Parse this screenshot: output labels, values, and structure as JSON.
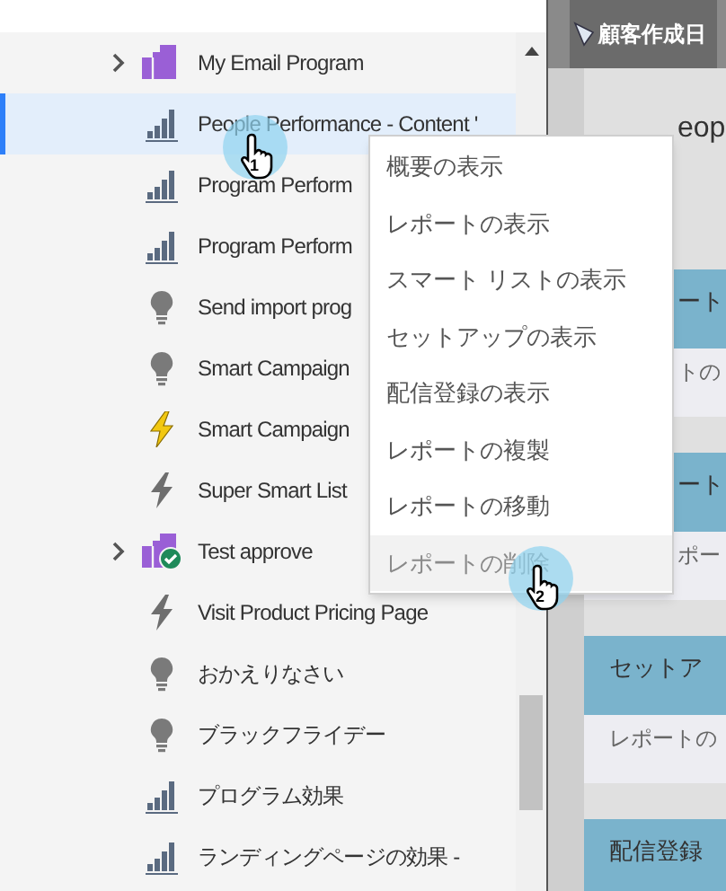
{
  "tree": {
    "items": [
      {
        "label": "My Email Program",
        "kind": "program",
        "expanded": false,
        "selected": false
      },
      {
        "label": "People Performance - Content '",
        "kind": "report",
        "selected": true
      },
      {
        "label": "Program Perform",
        "kind": "report",
        "selected": false
      },
      {
        "label": "Program Perform",
        "kind": "report",
        "selected": false
      },
      {
        "label": "Send import prog",
        "kind": "batch",
        "selected": false
      },
      {
        "label": "Smart Campaign",
        "kind": "batch",
        "selected": false
      },
      {
        "label": "Smart Campaign",
        "kind": "trigger_active",
        "selected": false
      },
      {
        "label": "Super Smart List",
        "kind": "trigger",
        "selected": false
      },
      {
        "label": "Test approve",
        "kind": "program_approved",
        "expanded": false,
        "selected": false
      },
      {
        "label": "Visit Product Pricing Page",
        "kind": "trigger",
        "selected": false
      },
      {
        "label": "おかえりなさい",
        "kind": "batch",
        "selected": false
      },
      {
        "label": "ブラックフライデー",
        "kind": "batch",
        "selected": false
      },
      {
        "label": "プログラム効果",
        "kind": "report",
        "selected": false
      },
      {
        "label": "ランディングページの効果 -",
        "kind": "report",
        "selected": false
      }
    ]
  },
  "context_menu": {
    "items": [
      {
        "label": "概要の表示",
        "hovered": false
      },
      {
        "label": "レポートの表示",
        "hovered": false
      },
      {
        "label": "スマート リストの表示",
        "hovered": false
      },
      {
        "label": "セットアップの表示",
        "hovered": false
      },
      {
        "label": "配信登録の表示",
        "hovered": false
      },
      {
        "label": "レポートの複製",
        "hovered": false
      },
      {
        "label": "レポートの移動",
        "hovered": false
      },
      {
        "label": "レポートの削除",
        "hovered": true
      }
    ]
  },
  "cursors": [
    {
      "step": "1"
    },
    {
      "step": "2"
    }
  ],
  "main": {
    "tab": "顧客作成日",
    "title": "eop",
    "cards": [
      {
        "header": "ート",
        "body": "トの"
      },
      {
        "header": "ート",
        "body": "ポー"
      },
      {
        "header": "セットア",
        "body": "レポートの"
      },
      {
        "header": "配信登録"
      }
    ]
  }
}
